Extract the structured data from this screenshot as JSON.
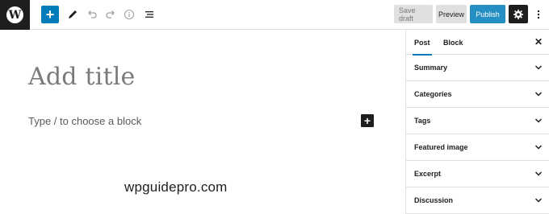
{
  "toolbar": {
    "logo_glyph": "W",
    "save_draft_label": "Save draft",
    "preview_label": "Preview",
    "publish_label": "Publish"
  },
  "editor": {
    "title_placeholder": "Add title",
    "block_placeholder": "Type / to choose a block"
  },
  "watermark": "wpguidepro.com",
  "sidebar": {
    "tabs": [
      {
        "label": "Post",
        "active": true
      },
      {
        "label": "Block",
        "active": false
      }
    ],
    "panels": [
      {
        "label": "Summary"
      },
      {
        "label": "Categories"
      },
      {
        "label": "Tags"
      },
      {
        "label": "Featured image"
      },
      {
        "label": "Excerpt"
      },
      {
        "label": "Discussion"
      }
    ]
  },
  "colors": {
    "accent": "#007cba",
    "dark": "#1e1e1e",
    "border": "#e0e0e0"
  }
}
